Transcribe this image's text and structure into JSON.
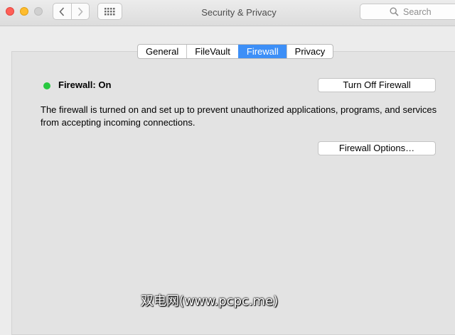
{
  "window": {
    "title": "Security & Privacy",
    "search_placeholder": "Search"
  },
  "tabs": [
    {
      "label": "General",
      "active": false
    },
    {
      "label": "FileVault",
      "active": false
    },
    {
      "label": "Firewall",
      "active": true
    },
    {
      "label": "Privacy",
      "active": false
    }
  ],
  "firewall": {
    "status_label": "Firewall: On",
    "status_color": "#28c840",
    "toggle_button_label": "Turn Off Firewall",
    "description": "The firewall is turned on and set up to prevent unauthorized applications, programs, and services from accepting incoming connections.",
    "options_button_label": "Firewall Options…"
  },
  "watermark": "双电网(www.pcpc.me)",
  "colors": {
    "accent": "#3d8ff7",
    "close": "#ff5f57",
    "minimize": "#febc2e"
  }
}
